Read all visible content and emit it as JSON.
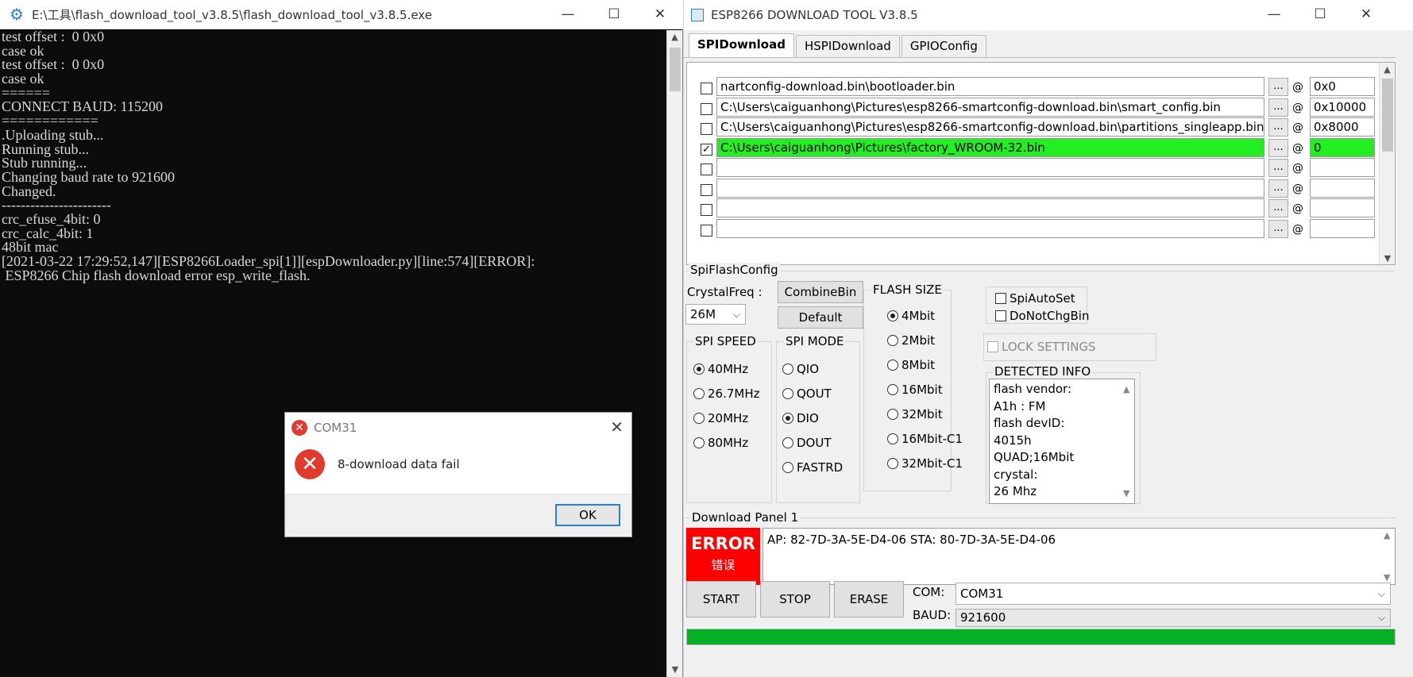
{
  "console": {
    "title": "E:\\工具\\flash_download_tool_v3.8.5\\flash_download_tool_v3.8.5.exe",
    "lines": [
      "test offset :  0 0x0",
      "case ok",
      "test offset :  0 0x0",
      "case ok",
      "======",
      "CONNECT BAUD: 115200",
      "============",
      ".Uploading stub...",
      "Running stub...",
      "Stub running...",
      "Changing baud rate to 921600",
      "Changed.",
      "-----------------------",
      "crc_efuse_4bit: 0",
      "crc_calc_4bit: 1",
      "48bit mac",
      "[2021-03-22 17:29:52,147][ESP8266Loader_spi[1]][espDownloader.py][line:574][ERROR]:",
      " ESP8266 Chip flash download error esp_write_flash."
    ]
  },
  "dialog": {
    "title": "COM31",
    "message": "8-download data fail",
    "ok_label": "OK"
  },
  "tool": {
    "title": "ESP8266 DOWNLOAD TOOL V3.8.5",
    "tabs": [
      {
        "label": "SPIDownload",
        "active": true
      },
      {
        "label": "HSPIDownload",
        "active": false
      },
      {
        "label": "GPIOConfig",
        "active": false
      }
    ],
    "files": [
      {
        "checked": false,
        "path": "nartconfig-download.bin\\bootloader.bin",
        "offset": "0x0",
        "selected": false
      },
      {
        "checked": false,
        "path": "C:\\Users\\caiguanhong\\Pictures\\esp8266-smartconfig-download.bin\\smart_config.bin",
        "offset": "0x10000",
        "selected": false
      },
      {
        "checked": false,
        "path": "C:\\Users\\caiguanhong\\Pictures\\esp8266-smartconfig-download.bin\\partitions_singleapp.bin",
        "offset": "0x8000",
        "selected": false
      },
      {
        "checked": true,
        "path": "C:\\Users\\caiguanhong\\Pictures\\factory_WROOM-32.bin",
        "offset": "0",
        "selected": true
      },
      {
        "checked": false,
        "path": "",
        "offset": "",
        "selected": false
      },
      {
        "checked": false,
        "path": "",
        "offset": "",
        "selected": false
      },
      {
        "checked": false,
        "path": "",
        "offset": "",
        "selected": false
      },
      {
        "checked": false,
        "path": "",
        "offset": "",
        "selected": false
      }
    ],
    "browse_label": "...",
    "at_label": "@",
    "spi_flash_config_label": "SpiFlashConfig",
    "crystal_freq_label": "CrystalFreq :",
    "crystal_freq_value": "26M",
    "combine_bin_label": "CombineBin",
    "default_label": "Default",
    "spi_speed_label": "SPI SPEED",
    "spi_speed_options": [
      {
        "label": "40MHz",
        "selected": true
      },
      {
        "label": "26.7MHz",
        "selected": false
      },
      {
        "label": "20MHz",
        "selected": false
      },
      {
        "label": "80MHz",
        "selected": false
      }
    ],
    "spi_mode_label": "SPI MODE",
    "spi_mode_options": [
      {
        "label": "QIO",
        "selected": false
      },
      {
        "label": "QOUT",
        "selected": false
      },
      {
        "label": "DIO",
        "selected": true
      },
      {
        "label": "DOUT",
        "selected": false
      },
      {
        "label": "FASTRD",
        "selected": false
      }
    ],
    "flash_size_label": "FLASH SIZE",
    "flash_size_options": [
      {
        "label": "4Mbit",
        "selected": true
      },
      {
        "label": "2Mbit",
        "selected": false
      },
      {
        "label": "8Mbit",
        "selected": false
      },
      {
        "label": "16Mbit",
        "selected": false
      },
      {
        "label": "32Mbit",
        "selected": false
      },
      {
        "label": "16Mbit-C1",
        "selected": false
      },
      {
        "label": "32Mbit-C1",
        "selected": false
      }
    ],
    "spi_auto_set_label": "SpiAutoSet",
    "do_not_chg_bin_label": "DoNotChgBin",
    "lock_settings_label": "LOCK SETTINGS",
    "detected_info_label": "DETECTED INFO",
    "detected_info_lines": [
      "flash vendor:",
      "A1h : FM",
      "flash devID:",
      "4015h",
      "QUAD;16Mbit",
      "crystal:",
      "26 Mhz"
    ],
    "download_panel_label": "Download Panel 1",
    "status_text": "ERROR",
    "status_subtext": "错误",
    "log_text": "AP:  82-7D-3A-5E-D4-06  STA:  80-7D-3A-5E-D4-06",
    "start_label": "START",
    "stop_label": "STOP",
    "erase_label": "ERASE",
    "com_label": "COM:",
    "com_value": "COM31",
    "baud_label": "BAUD:",
    "baud_value": "921600",
    "progress": 1.0,
    "colors": {
      "success_green": "#22ee22",
      "error_red": "#ff0000",
      "progress_green": "#06b025"
    }
  }
}
